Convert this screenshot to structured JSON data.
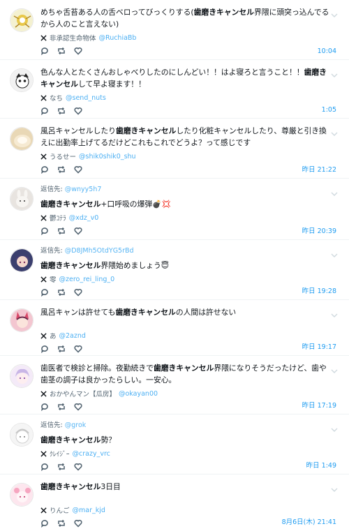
{
  "colors": {
    "accent": "#1d9bf0",
    "muted": "#536471",
    "divider": "#eff3f4"
  },
  "tweets": [
    {
      "reply_to_label": "",
      "reply_to_handle": "",
      "text_before": "めちゃ舌苔ある人の舌ベロってびっくりする(",
      "keyword": "歯磨きキャンセル",
      "text_after": "界隈に頭突っ込んでるから人のこと言えない)",
      "author": "非承認生命物体",
      "handle": "@RuchiaBb",
      "time": "10:04"
    },
    {
      "reply_to_label": "",
      "reply_to_handle": "",
      "text_before": "色んな人とたくさんおしゃべりしたのにしんどい！！はよ寝ろと言うこと！！",
      "keyword": "歯磨きキャンセル",
      "text_after": "して早よ寝ます！！",
      "author": "なち",
      "handle": "@send_nuts",
      "time": "1:05"
    },
    {
      "reply_to_label": "",
      "reply_to_handle": "",
      "text_before": "風呂キャンセルしたり",
      "keyword": "歯磨きキャンセル",
      "text_after": "したり化粧キャンセルしたり、尊厳と引き換えに出勤率上げてるだけどこれもこれでどうよ？って感じです",
      "author": "うるせー",
      "handle": "@shik0shik0_shu",
      "time": "昨日 21:22"
    },
    {
      "reply_to_label": "返信先:",
      "reply_to_handle": "@wnyy5h7",
      "text_before": "",
      "keyword": "歯磨きキャンセル",
      "text_after": "+口呼吸の爆弾💣💢",
      "author": "鬱ｺﾃﾗ",
      "handle": "@xdz_v0",
      "time": "昨日 20:39"
    },
    {
      "reply_to_label": "返信先:",
      "reply_to_handle": "@D8JMh5OtdYG5rBd",
      "text_before": "",
      "keyword": "歯磨きキャンセル",
      "text_after": "界隈始めましょう😇",
      "author": "零",
      "handle": "@zero_rei_ling_0",
      "time": "昨日 19:28"
    },
    {
      "reply_to_label": "",
      "reply_to_handle": "",
      "text_before": "風呂キャンは許せても",
      "keyword": "歯磨きキャンセル",
      "text_after": "の人間は許せない",
      "author": "あ",
      "handle": "@2aznd",
      "time": "昨日 19:17"
    },
    {
      "reply_to_label": "",
      "reply_to_handle": "",
      "text_before": "歯医者で検診と掃除。夜勤続きで",
      "keyword": "歯磨きキャンセル",
      "text_after": "界隈になりそうだったけど、歯や歯茎の調子は良かったらしい。一安心。",
      "author": "おかやんマン【瓜房】",
      "handle": "@okayan00",
      "time": "昨日 17:19"
    },
    {
      "reply_to_label": "返信先:",
      "reply_to_handle": "@grok",
      "text_before": "",
      "keyword": "歯磨きキャンセル",
      "text_after": "勢？",
      "author": "ｸﾚｲｼﾞｰ",
      "handle": "@crazy_vrc",
      "time": "昨日 1:49"
    },
    {
      "reply_to_label": "",
      "reply_to_handle": "",
      "text_before": "",
      "keyword": "歯磨きキャンセル",
      "text_after": "3日目",
      "author": "りんご",
      "handle": "@mar_kjd",
      "time": "8月6日(木) 21:41"
    }
  ]
}
